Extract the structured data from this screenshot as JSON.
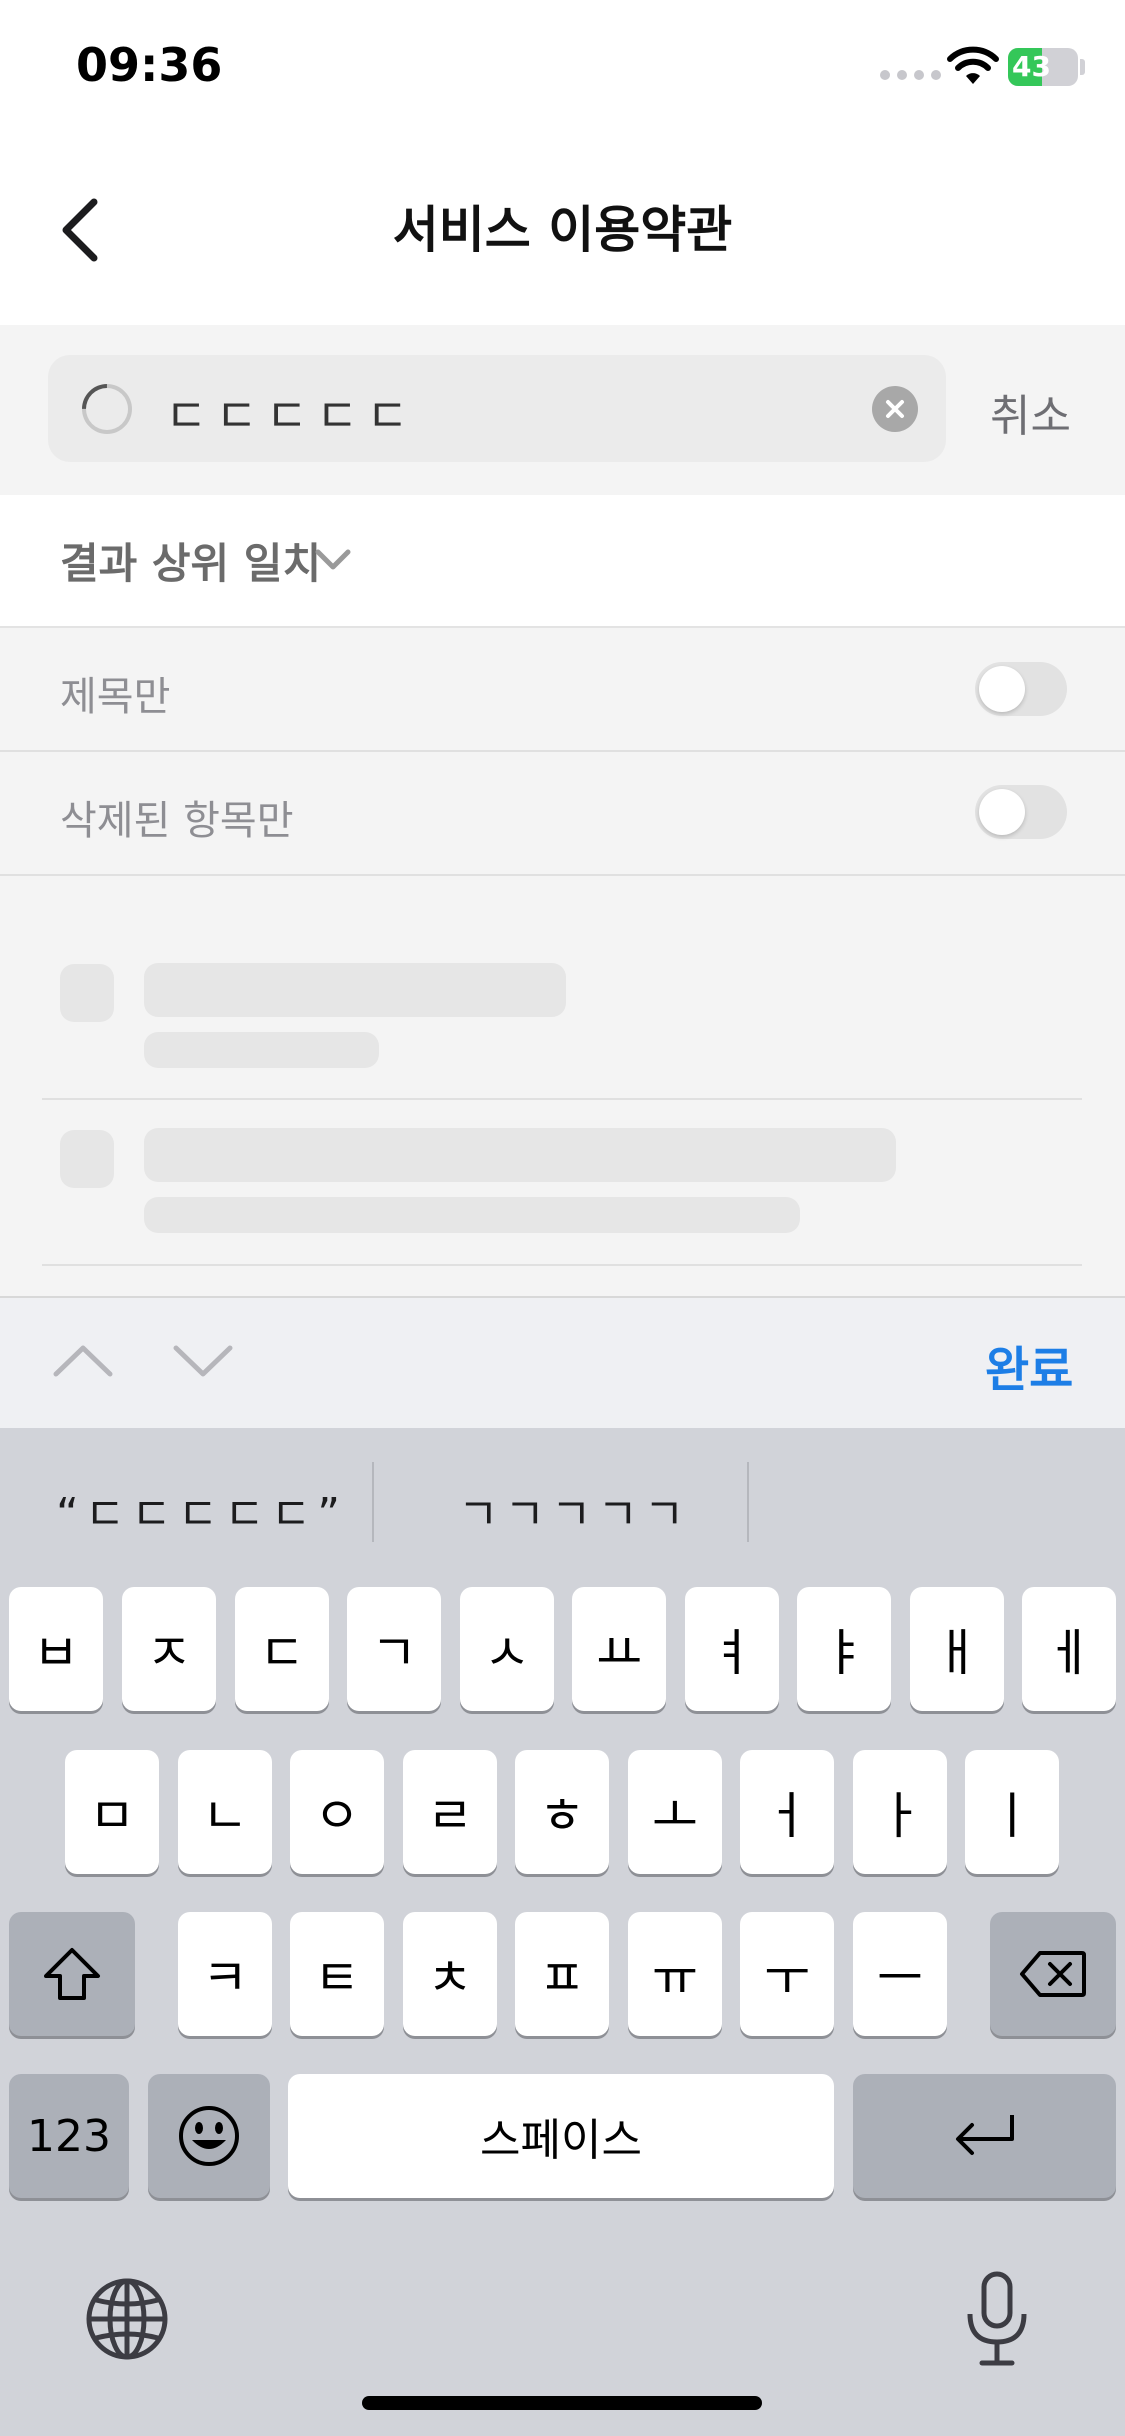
{
  "status_bar": {
    "time": "09:36",
    "battery": "43"
  },
  "nav": {
    "title": "서비스 이용약관"
  },
  "search": {
    "query": "ㄷㄷㄷㄷㄷ",
    "cancel": "취소"
  },
  "sort": {
    "label": "결과 상위 일치"
  },
  "filters": [
    {
      "label": "제목만",
      "on": false
    },
    {
      "label": "삭제된 항목만",
      "on": false
    }
  ],
  "accessory": {
    "done": "완료"
  },
  "keyboard": {
    "suggestions": [
      "“ㄷㄷㄷㄷㄷ”",
      "ㄱㄱㄱㄱㄱ"
    ],
    "row1": [
      "ㅂ",
      "ㅈ",
      "ㄷ",
      "ㄱ",
      "ㅅ",
      "ㅛ",
      "ㅕ",
      "ㅑ",
      "ㅐ",
      "ㅔ"
    ],
    "row2": [
      "ㅁ",
      "ㄴ",
      "ㅇ",
      "ㄹ",
      "ㅎ",
      "ㅗ",
      "ㅓ",
      "ㅏ",
      "ㅣ"
    ],
    "row3": [
      "ㅋ",
      "ㅌ",
      "ㅊ",
      "ㅍ",
      "ㅠ",
      "ㅜ",
      "ㅡ"
    ],
    "numbers": "123",
    "space": "스페이스"
  },
  "icons": {
    "back": "chevron-left-icon",
    "spinner": "loading-spinner-icon",
    "clear": "clear-circle-icon",
    "sort_chevron": "chevron-down-icon",
    "shift": "shift-icon",
    "delete": "delete-icon",
    "emoji": "emoji-icon",
    "return": "return-icon",
    "globe": "globe-icon",
    "mic": "microphone-icon"
  },
  "colors": {
    "accent": "#1d7ee6",
    "battery": "#34c759"
  }
}
